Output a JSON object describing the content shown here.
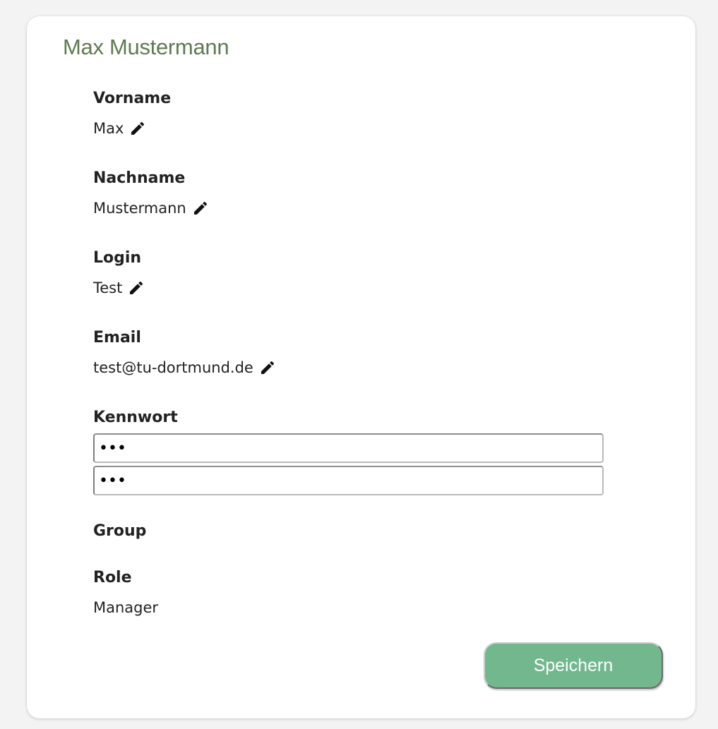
{
  "user": {
    "full_name": "Max Mustermann"
  },
  "fields": {
    "firstname": {
      "label": "Vorname",
      "value": "Max"
    },
    "lastname": {
      "label": "Nachname",
      "value": "Mustermann"
    },
    "login": {
      "label": "Login",
      "value": "Test"
    },
    "email": {
      "label": "Email",
      "value": "test@tu-dortmund.de"
    },
    "password": {
      "label": "Kennwort",
      "value": "•••",
      "confirm_value": "•••"
    },
    "group": {
      "label": "Group",
      "value": ""
    },
    "role": {
      "label": "Role",
      "value": "Manager"
    }
  },
  "actions": {
    "save_label": "Speichern"
  },
  "icons": {
    "edit": "pencil-icon"
  },
  "colors": {
    "title": "#5f7a52",
    "save_button": "#72b78e",
    "background": "#f3f3f3"
  }
}
